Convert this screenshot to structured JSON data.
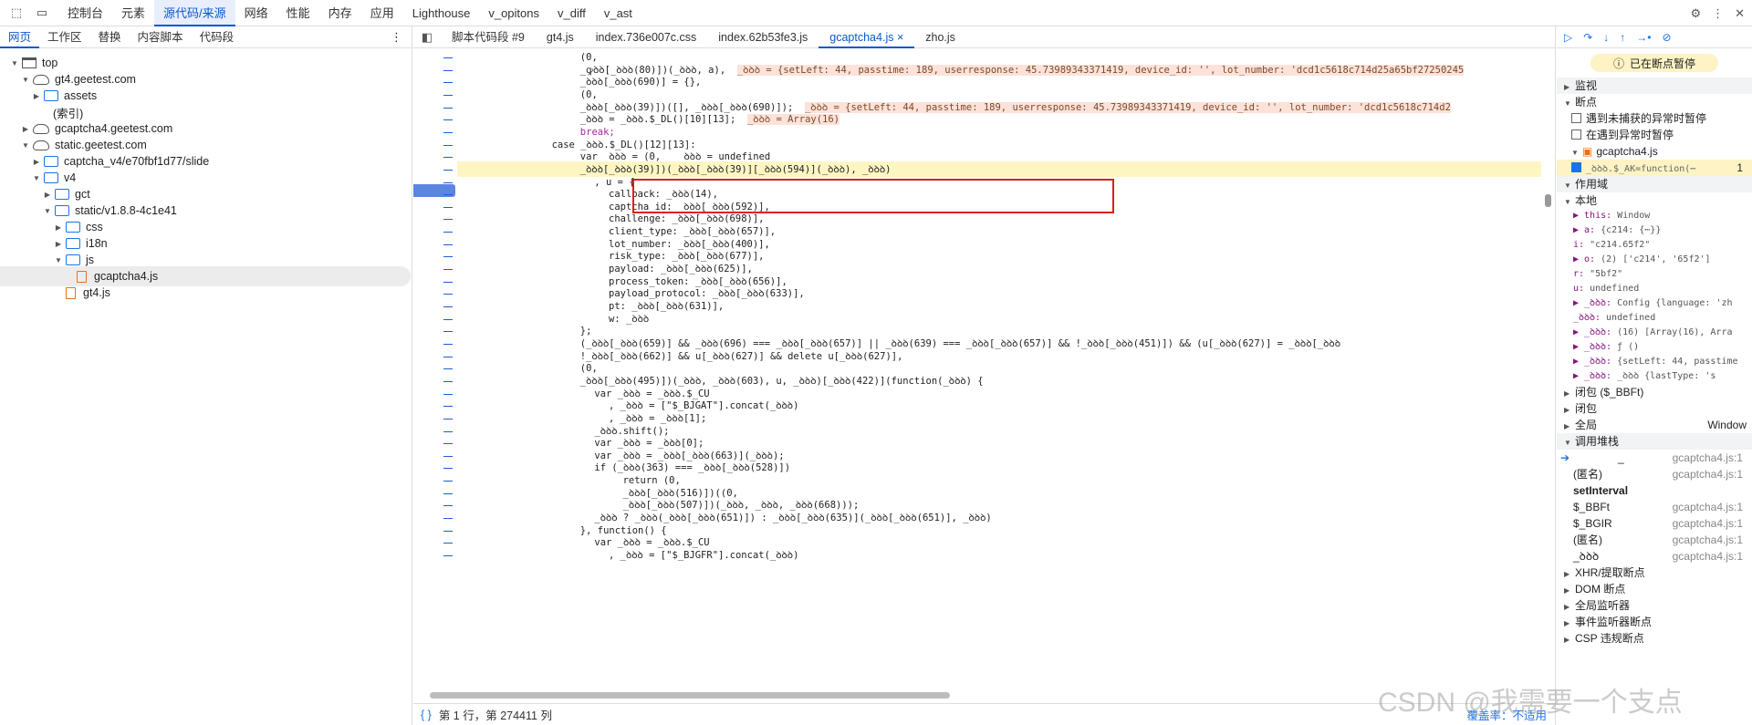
{
  "toolbar": {
    "tabs": [
      "控制台",
      "元素",
      "源代码/来源",
      "网络",
      "性能",
      "内存",
      "应用",
      "Lighthouse",
      "v_opitons",
      "v_diff",
      "v_ast"
    ],
    "active": "源代码/来源"
  },
  "left": {
    "tabs": [
      "网页",
      "工作区",
      "替换",
      "内容脚本",
      "代码段"
    ],
    "tree": [
      {
        "label": "top",
        "depth": 0,
        "kind": "frame",
        "caret": "open"
      },
      {
        "label": "gt4.geetest.com",
        "depth": 1,
        "kind": "cloud",
        "caret": "open"
      },
      {
        "label": "assets",
        "depth": 2,
        "kind": "folder",
        "caret": "closed"
      },
      {
        "label": "(索引)",
        "depth": 3,
        "kind": "none",
        "caret": ""
      },
      {
        "label": "gcaptcha4.geetest.com",
        "depth": 1,
        "kind": "cloud",
        "caret": "closed"
      },
      {
        "label": "static.geetest.com",
        "depth": 1,
        "kind": "cloud",
        "caret": "open"
      },
      {
        "label": "captcha_v4/e70fbf1d77/slide",
        "depth": 2,
        "kind": "folder",
        "caret": "closed"
      },
      {
        "label": "v4",
        "depth": 2,
        "kind": "folder",
        "caret": "open"
      },
      {
        "label": "gct",
        "depth": 3,
        "kind": "folder",
        "caret": "closed"
      },
      {
        "label": "static/v1.8.8-4c1e41",
        "depth": 3,
        "kind": "folder",
        "caret": "open"
      },
      {
        "label": "css",
        "depth": 4,
        "kind": "folder",
        "caret": "closed"
      },
      {
        "label": "i18n",
        "depth": 4,
        "kind": "folder",
        "caret": "closed"
      },
      {
        "label": "js",
        "depth": 4,
        "kind": "folder",
        "caret": "open"
      },
      {
        "label": "gcaptcha4.js",
        "depth": 5,
        "kind": "file",
        "caret": "",
        "selected": true
      },
      {
        "label": "gt4.js",
        "depth": 4,
        "kind": "file",
        "caret": ""
      }
    ]
  },
  "editor": {
    "tabs": [
      "脚本代码段 #9",
      "gt4.js",
      "index.736e007c.css",
      "index.62b53fe3.js",
      "gcaptcha4.js ×",
      "zho.js"
    ],
    "active": "gcaptcha4.js ×",
    "lines": [
      {
        "t": "(0,",
        "i": 16
      },
      {
        "t": "_ꝙꝺꝺ[_ꝺꝺꝺ(80)])(_ꝺꝺꝺ, a),",
        "i": 16,
        "inl": "_ꝺꝺꝺ = {setLeft: 44, passtime: 189, userresponse: 45.73989343371419, device_id: '', lot_number: 'dcd1c5618c714d25a65bf27250245"
      },
      {
        "t": "_ꝺꝺꝺ[_ꝺꝺꝺ(690)] = {},",
        "i": 16
      },
      {
        "t": "(0,",
        "i": 16
      },
      {
        "t": "_ꝺꝺꝺ[_ꝺꝺꝺ(39)])([], _ꝺꝺꝺ[_ꝺꝺꝺ(690)]);",
        "i": 16,
        "inl": "_ꝺꝺꝺ = {setLeft: 44, passtime: 189, userresponse: 45.73989343371419, device_id: '', lot_number: 'dcd1c5618c714d2"
      },
      {
        "t": "_ꝺꝺꝺ = _ꝺꝺꝺ.$_DL()[10][13];",
        "i": 16,
        "inl": "_ꝺꝺꝺ = Array(16)"
      },
      {
        "t": "break;",
        "i": 16,
        "kw": true
      },
      {
        "t": "case _ꝺꝺꝺ.$_DL()[12][13]:",
        "i": 12
      },
      {
        "t": "var _ꝺꝺꝺ = (0,   _ꝺꝺꝺ = undefined",
        "i": 16
      },
      {
        "t": "_ꝺꝺꝺ[_ꝺꝺꝺ(39)])(_ꝺꝺꝺ[_ꝺꝺꝺ(39)][_ꝺꝺꝺ(594)](_ꝺꝺꝺ), _ꝺꝺꝺ)",
        "i": 16,
        "hl": true
      },
      {
        "t": ", u = {",
        "i": 18
      },
      {
        "t": "callback: _ꝺꝺꝺ(14),",
        "i": 20
      },
      {
        "t": "captcha_id: _ꝺꝺꝺ[_ꝺꝺꝺ(592)],",
        "i": 20
      },
      {
        "t": "challenge: _ꝺꝺꝺ[_ꝺꝺꝺ(698)],",
        "i": 20
      },
      {
        "t": "client_type: _ꝺꝺꝺ[_ꝺꝺꝺ(657)],",
        "i": 20
      },
      {
        "t": "lot_number: _ꝺꝺꝺ[_ꝺꝺꝺ(400)],",
        "i": 20
      },
      {
        "t": "risk_type: _ꝺꝺꝺ[_ꝺꝺꝺ(677)],",
        "i": 20
      },
      {
        "t": "payload: _ꝺꝺꝺ[_ꝺꝺꝺ(625)],",
        "i": 20
      },
      {
        "t": "process_token: _ꝺꝺꝺ[_ꝺꝺꝺ(656)],",
        "i": 20
      },
      {
        "t": "payload_protocol: _ꝺꝺꝺ[_ꝺꝺꝺ(633)],",
        "i": 20
      },
      {
        "t": "pt: _ꝺꝺꝺ[_ꝺꝺꝺ(631)],",
        "i": 20
      },
      {
        "t": "w: _ꝺꝺꝺ",
        "i": 20
      },
      {
        "t": "};",
        "i": 16
      },
      {
        "t": "(_ꝺꝺꝺ[_ꝺꝺꝺ(659)] && _ꝺꝺꝺ(696) === _ꝺꝺꝺ[_ꝺꝺꝺ(657)] || _ꝺꝺꝺ(639) === _ꝺꝺꝺ[_ꝺꝺꝺ(657)] && !_ꝺꝺꝺ[_ꝺꝺꝺ(451)]) && (u[_ꝺꝺꝺ(627)] = _ꝺꝺꝺ[_ꝺꝺꝺ",
        "i": 16
      },
      {
        "t": "!_ꝺꝺꝺ[_ꝺꝺꝺ(662)] && u[_ꝺꝺꝺ(627)] && delete u[_ꝺꝺꝺ(627)],",
        "i": 16
      },
      {
        "t": "(0,",
        "i": 16
      },
      {
        "t": "_ꝺꝺꝺ[_ꝺꝺꝺ(495)])(_ꝺꝺꝺ, _ꝺꝺꝺ(603), u, _ꝺꝺꝺ)[_ꝺꝺꝺ(422)](function(_ꝺꝺꝺ) {",
        "i": 16
      },
      {
        "t": "var _ꝺꝺꝺ = _ꝺꝺꝺ.$_CU",
        "i": 18
      },
      {
        "t": ", _ꝺꝺꝺ = [\"$_BJGAT\"].concat(_ꝺꝺꝺ)",
        "i": 20
      },
      {
        "t": ", _ꝺꝺꝺ = _ꝺꝺꝺ[1];",
        "i": 20
      },
      {
        "t": "_ꝺꝺꝺ.shift();",
        "i": 18
      },
      {
        "t": "var _ꝺꝺꝺ = _ꝺꝺꝺ[0];",
        "i": 18
      },
      {
        "t": "var _ꝺꝺꝺ = _ꝺꝺꝺ[_ꝺꝺꝺ(663)](_ꝺꝺꝺ);",
        "i": 18
      },
      {
        "t": "if (_ꝺꝺꝺ(363) === _ꝺꝺꝺ[_ꝺꝺꝺ(528)])",
        "i": 18
      },
      {
        "t": "return (0,",
        "i": 22
      },
      {
        "t": "_ꝺꝺꝺ[_ꝺꝺꝺ(516)])((0,",
        "i": 22
      },
      {
        "t": "_ꝺꝺꝺ[_ꝺꝺꝺ(507)])(_ꝺꝺꝺ, _ꝺꝺꝺ, _ꝺꝺꝺ(668)));",
        "i": 22
      },
      {
        "t": "_ꝺꝺꝺ ? _ꝺꝺꝺ(_ꝺꝺꝺ[_ꝺꝺꝺ(651)]) : _ꝺꝺꝺ[_ꝺꝺꝺ(635)](_ꝺꝺꝺ[_ꝺꝺꝺ(651)], _ꝺꝺꝺ)",
        "i": 18
      },
      {
        "t": "}, function() {",
        "i": 16
      },
      {
        "t": "var _ꝺꝺꝺ = _ꝺꝺꝺ.$_CU",
        "i": 18
      },
      {
        "t": ", _ꝺꝺꝺ = [\"$_BJGFR\"].concat(_ꝺꝺꝺ)",
        "i": 20
      }
    ],
    "status": "第 1 行，第 274411 列",
    "coverage": "覆盖率：不适用"
  },
  "right": {
    "paused": "已在断点暂停",
    "watch": "监视",
    "breakpoints": "断点",
    "opts": [
      "遇到未捕获的异常时暂停",
      "在遇到异常时暂停"
    ],
    "bpfile": "gcaptcha4.js",
    "bpline": "_ꝺꝺꝺ.$_AK=function(⋯",
    "bpnum": "1",
    "scope": "作用域",
    "local": "本地",
    "scopeRows": [
      {
        "k": "▶ this:",
        "v": " Window"
      },
      {
        "k": "▶ a:",
        "v": " {c214: {⋯}}"
      },
      {
        "k": "  i:",
        "v": " \"c214.65f2\""
      },
      {
        "k": "▶ o:",
        "v": " (2) ['c214', '65f2']"
      },
      {
        "k": "  r:",
        "v": " \"5bf2\""
      },
      {
        "k": "  u:",
        "v": " undefined"
      },
      {
        "k": "▶ _ꝺꝺꝺ:",
        "v": " Config {language: 'zh"
      },
      {
        "k": "  _ꝺꝺꝺ:",
        "v": " undefined"
      },
      {
        "k": "▶ _ꝺꝺꝺ:",
        "v": " (16) [Array(16), Arra"
      },
      {
        "k": "▶ _ꝺꝺꝺ:",
        "v": " ƒ ()"
      },
      {
        "k": "▶ _ꝺꝺꝺ:",
        "v": " {setLeft: 44, passtime"
      },
      {
        "k": "▶ _ꝺꝺꝺ:",
        "v": " _ꝺꝺꝺ {lastType: 's"
      }
    ],
    "closure1": "闭包 ($_BBFt)",
    "closure2": "闭包",
    "global": "全局",
    "globalVal": "Window",
    "callstack": "调用堆栈",
    "frames": [
      {
        "n": "_",
        "l": "gcaptcha4.js:1",
        "cur": true
      },
      {
        "n": "(匿名)",
        "l": "gcaptcha4.js:1"
      },
      {
        "n": "setInterval",
        "l": "",
        "bold": true
      },
      {
        "n": "$_BBFt",
        "l": "gcaptcha4.js:1"
      },
      {
        "n": "$_BGIR",
        "l": "gcaptcha4.js:1"
      },
      {
        "n": "(匿名)",
        "l": "gcaptcha4.js:1"
      },
      {
        "n": "_ꝺꝺꝺ",
        "l": "gcaptcha4.js:1"
      }
    ],
    "more": [
      "XHR/提取断点",
      "DOM 断点",
      "全局监听器",
      "事件监听器断点",
      "CSP 违规断点"
    ]
  },
  "watermark": "CSDN @我需要一个支点"
}
